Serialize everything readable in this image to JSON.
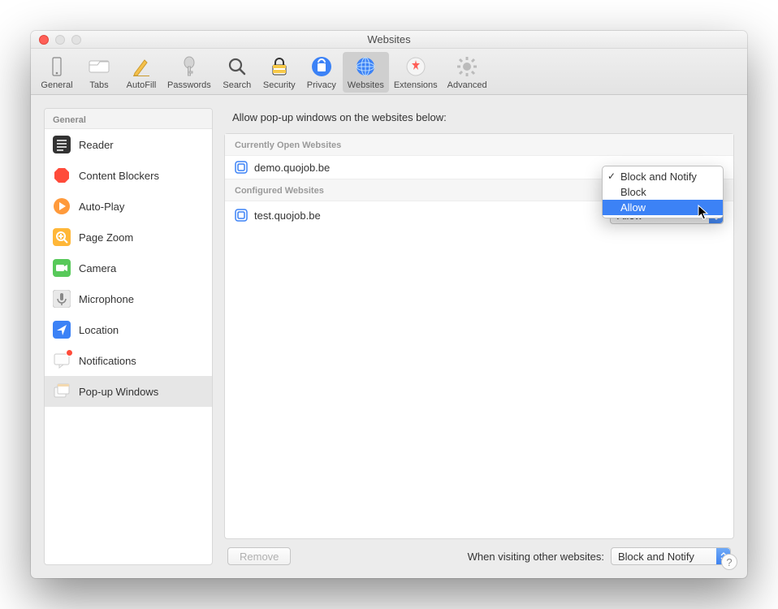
{
  "window": {
    "title": "Websites"
  },
  "toolbar": {
    "items": [
      {
        "label": "General"
      },
      {
        "label": "Tabs"
      },
      {
        "label": "AutoFill"
      },
      {
        "label": "Passwords"
      },
      {
        "label": "Search"
      },
      {
        "label": "Security"
      },
      {
        "label": "Privacy"
      },
      {
        "label": "Websites"
      },
      {
        "label": "Extensions"
      },
      {
        "label": "Advanced"
      }
    ],
    "selected_index": 7
  },
  "sidebar": {
    "header": "General",
    "items": [
      {
        "label": "Reader"
      },
      {
        "label": "Content Blockers"
      },
      {
        "label": "Auto-Play"
      },
      {
        "label": "Page Zoom"
      },
      {
        "label": "Camera"
      },
      {
        "label": "Microphone"
      },
      {
        "label": "Location"
      },
      {
        "label": "Notifications"
      },
      {
        "label": "Pop-up Windows"
      }
    ],
    "selected_index": 8
  },
  "main": {
    "title": "Allow pop-up windows on the websites below:",
    "sections": {
      "open_header": "Currently Open Websites",
      "configured_header": "Configured Websites"
    },
    "open_rows": [
      {
        "site": "demo.quojob.be",
        "dropdown_open": true,
        "dropdown": {
          "options": [
            {
              "label": "Block and Notify",
              "checked": true
            },
            {
              "label": "Block",
              "checked": false
            },
            {
              "label": "Allow",
              "checked": false,
              "highlight": true
            }
          ]
        }
      }
    ],
    "configured_rows": [
      {
        "site": "test.quojob.be",
        "value": "Allow"
      }
    ],
    "remove_label": "Remove",
    "default_label": "When visiting other websites:",
    "default_value": "Block and Notify"
  },
  "help_label": "?"
}
